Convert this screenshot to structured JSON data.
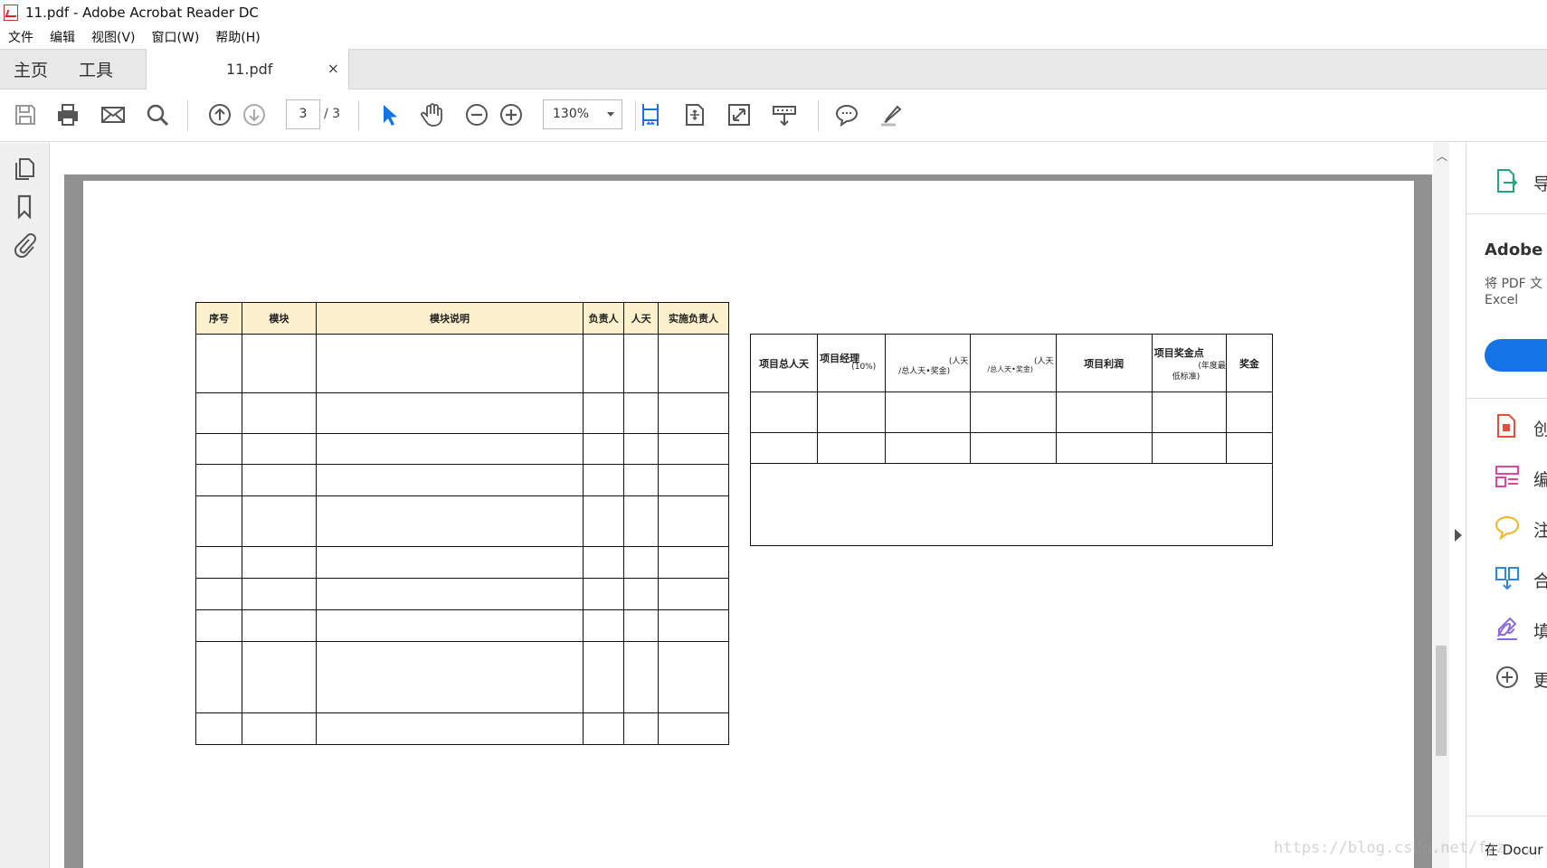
{
  "window": {
    "title": "11.pdf - Adobe Acrobat Reader DC"
  },
  "menu": [
    "文件",
    "编辑",
    "视图(V)",
    "窗口(W)",
    "帮助(H)"
  ],
  "tabs": {
    "home": "主页",
    "tools": "工具",
    "document": "11.pdf",
    "close": "×"
  },
  "toolbar": {
    "page_current": "3",
    "page_total": "/ 3",
    "zoom": "130%",
    "icons": [
      "save-icon",
      "print-icon",
      "email-icon",
      "search-icon",
      "prev-page-icon",
      "next-page-icon",
      "select-cursor-icon",
      "hand-icon",
      "zoom-out-icon",
      "zoom-in-icon",
      "fit-page-icon",
      "scroll-mode-icon",
      "full-screen-icon",
      "read-mode-icon",
      "comment-icon",
      "highlight-icon"
    ]
  },
  "left_rail": [
    "pages-icon",
    "bookmark-icon",
    "attachment-icon"
  ],
  "table1": {
    "headers": [
      "序号",
      "模块",
      "模块说明",
      "负责人",
      "人天",
      "实施负责人"
    ],
    "row_count": 10
  },
  "table2": {
    "headers": {
      "h1": "项目总人天",
      "h2_title": "项目经理",
      "h2_sub": "(10%)",
      "h3_top": "(人天",
      "h3_bottom": "/总人天•奖金)",
      "h4_top": "(人天",
      "h4_bottom": "/总人天•奖金)",
      "h5": "项目利润",
      "h6_title": "项目奖金点",
      "h6_sub": "(年度最",
      "h6_sub2": "低标准)",
      "h7": "奖金"
    }
  },
  "right_panel": {
    "export_label": "导",
    "heading": "Adobe A",
    "desc_line1": "将 PDF 文",
    "desc_line2": "Excel",
    "tools": [
      {
        "icon": "create-pdf-icon",
        "label": "创",
        "color": "#e0513d"
      },
      {
        "icon": "edit-pdf-icon",
        "label": "编",
        "color": "#d9489a"
      },
      {
        "icon": "comment-tool-icon",
        "label": "注",
        "color": "#f0b429"
      },
      {
        "icon": "combine-files-icon",
        "label": "合",
        "color": "#2d86d9"
      },
      {
        "icon": "fill-sign-icon",
        "label": "填",
        "color": "#8a6bd6"
      },
      {
        "icon": "more-tools-icon",
        "label": "更",
        "color": "#555555"
      }
    ],
    "footer": "在 Docur"
  },
  "watermark": "https://blog.csdn.net/fzz..."
}
